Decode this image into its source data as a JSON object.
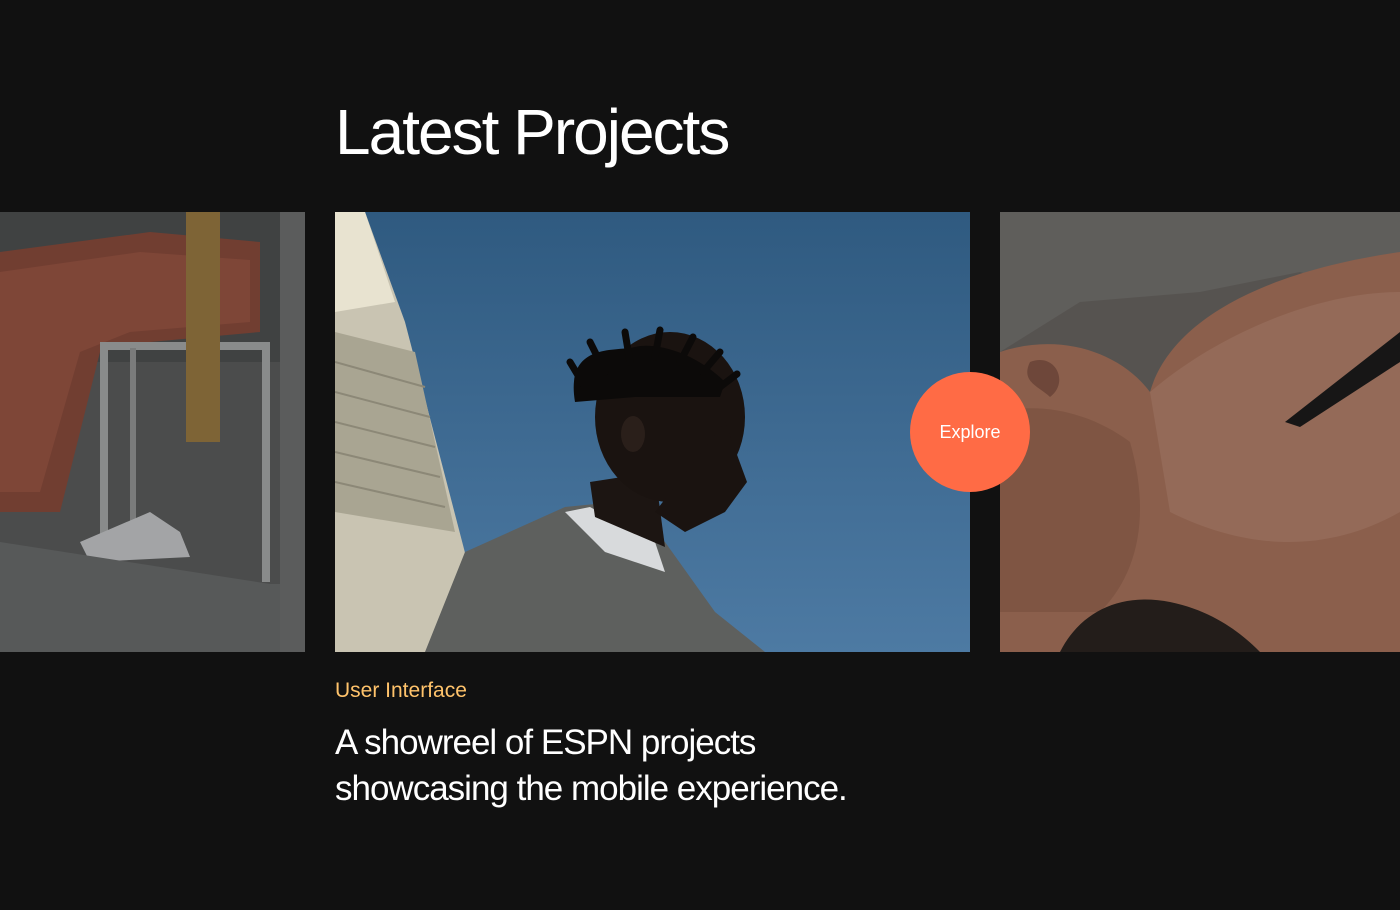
{
  "section": {
    "title": "Latest Projects"
  },
  "cards": {
    "left": {
      "icon": "photo-person-on-chair"
    },
    "main": {
      "icon": "photo-man-against-blue-sky"
    },
    "right": {
      "icon": "photo-person-lying-closeup"
    }
  },
  "explore": {
    "label": "Explore",
    "color": "#ff6b45"
  },
  "project": {
    "category": "User Interface",
    "category_color": "#ffc36b",
    "description_line1": "A showreel of ESPN projects",
    "description_line2": "showcasing the mobile experience."
  },
  "colors": {
    "background": "#111111",
    "text": "#ffffff"
  }
}
